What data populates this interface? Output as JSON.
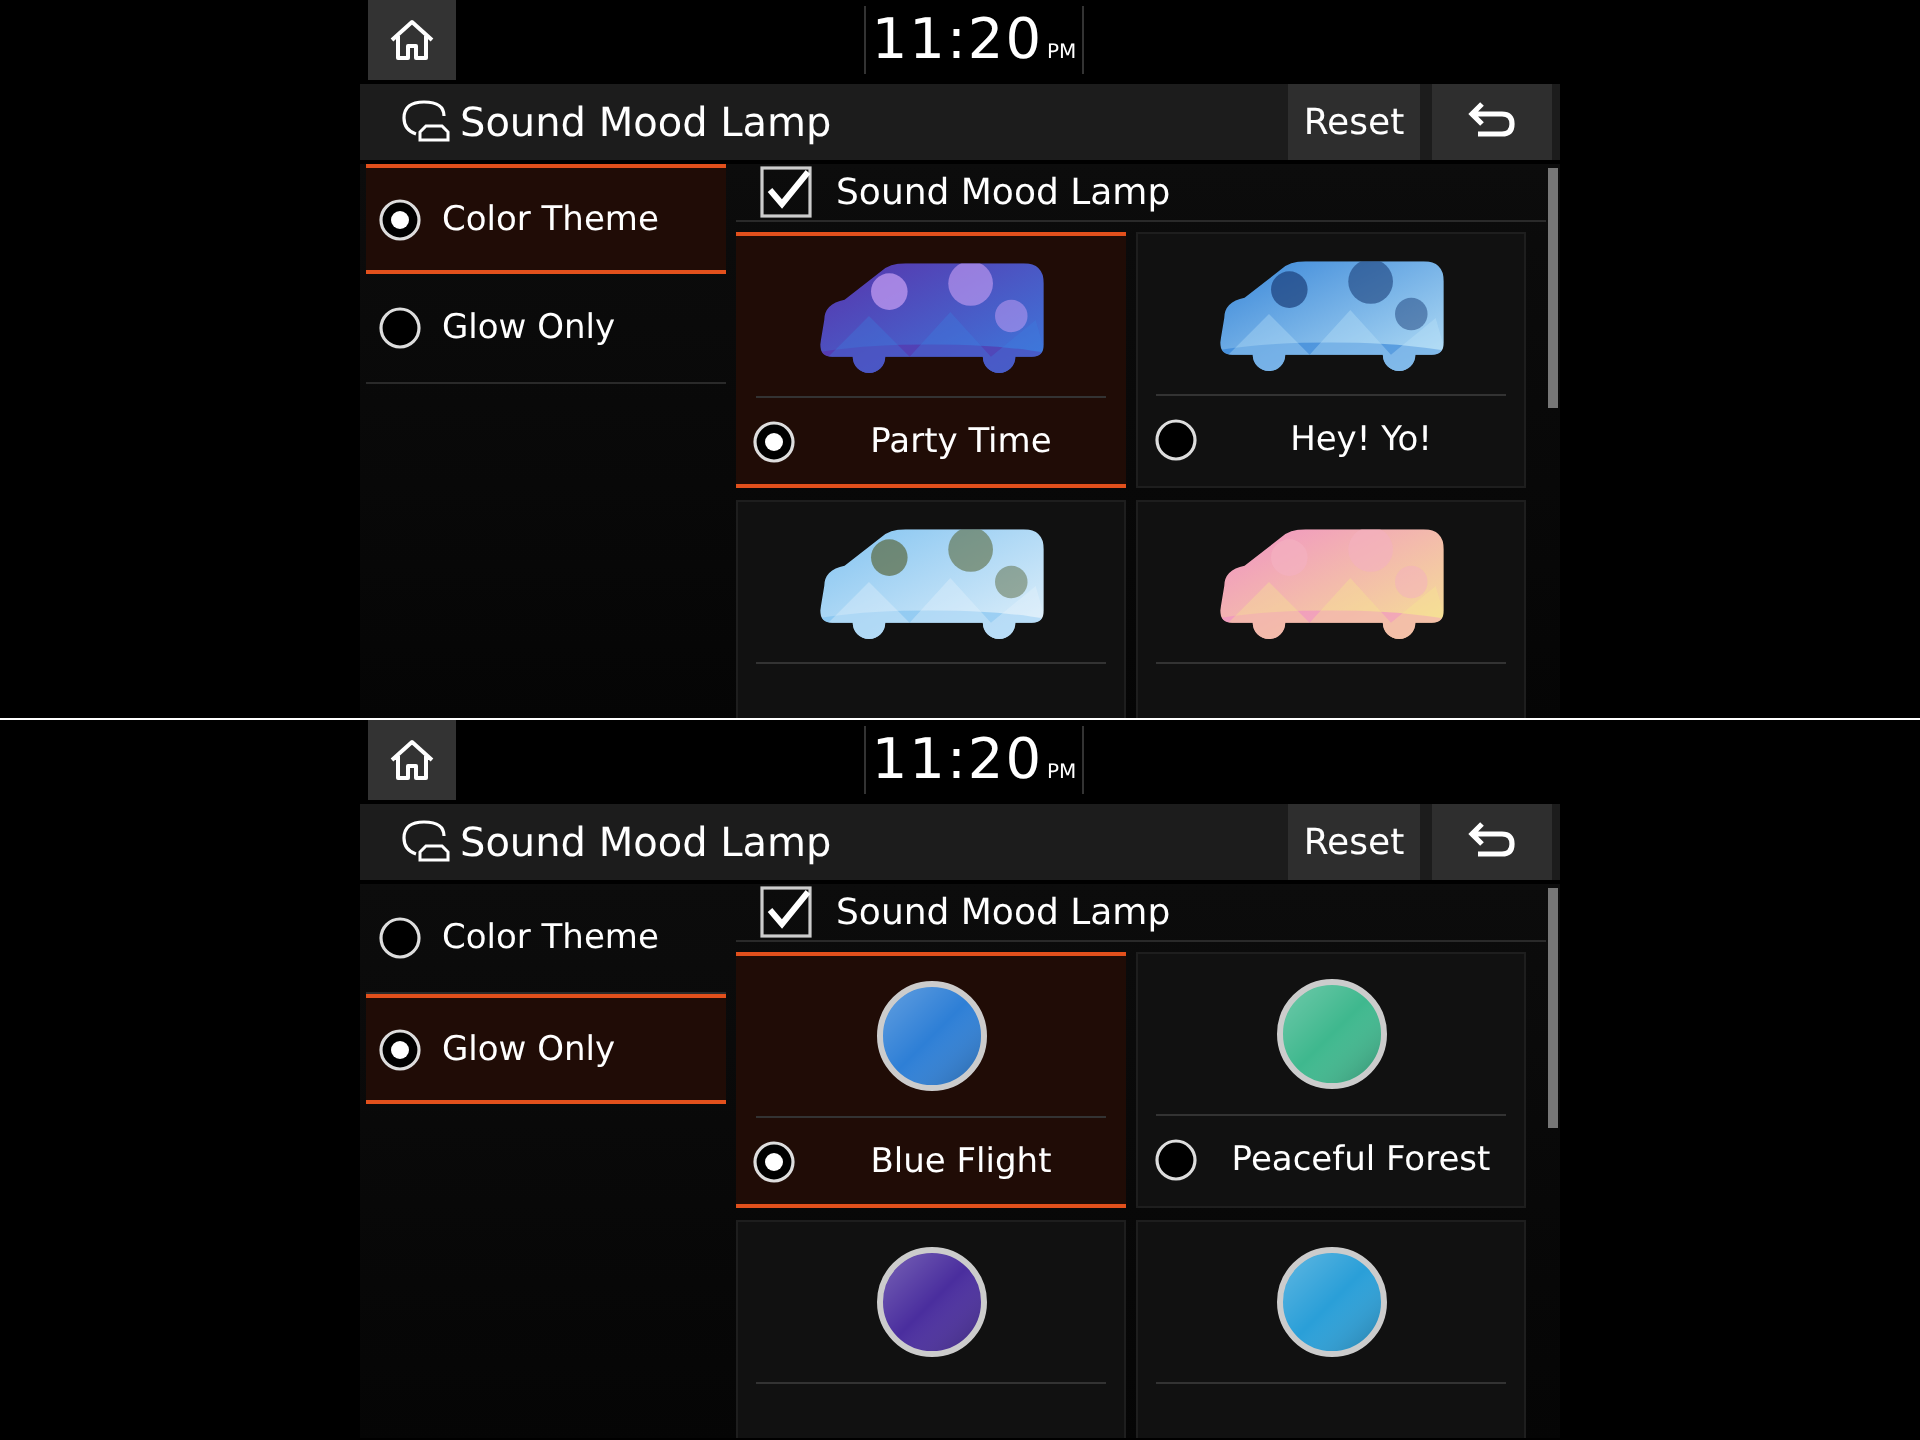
{
  "screens": [
    {
      "clock": {
        "time": "11:20",
        "ampm": "PM"
      },
      "title": "Sound Mood Lamp",
      "reset": "Reset",
      "modes": [
        {
          "label": "Color Theme",
          "selected": true
        },
        {
          "label": "Glow Only",
          "selected": false
        }
      ],
      "toggle": {
        "label": "Sound Mood Lamp",
        "checked": true
      },
      "themes": [
        {
          "kind": "car",
          "label": "Party Time",
          "selected": true
        },
        {
          "kind": "car",
          "label": "Hey! Yo!",
          "selected": false
        },
        {
          "kind": "car"
        },
        {
          "kind": "car"
        }
      ]
    },
    {
      "clock": {
        "time": "11:20",
        "ampm": "PM"
      },
      "title": "Sound Mood Lamp",
      "reset": "Reset",
      "modes": [
        {
          "label": "Color Theme",
          "selected": false
        },
        {
          "label": "Glow Only",
          "selected": true
        }
      ],
      "toggle": {
        "label": "Sound Mood Lamp",
        "checked": true
      },
      "themes": [
        {
          "kind": "orb",
          "color": "#2e7fd6",
          "label": "Blue Flight",
          "selected": true
        },
        {
          "kind": "orb",
          "color": "#3fb88e",
          "label": "Peaceful Forest",
          "selected": false
        },
        {
          "kind": "orb",
          "color": "#4a2e9e"
        },
        {
          "kind": "orb",
          "color": "#2a9fd8"
        }
      ]
    }
  ]
}
